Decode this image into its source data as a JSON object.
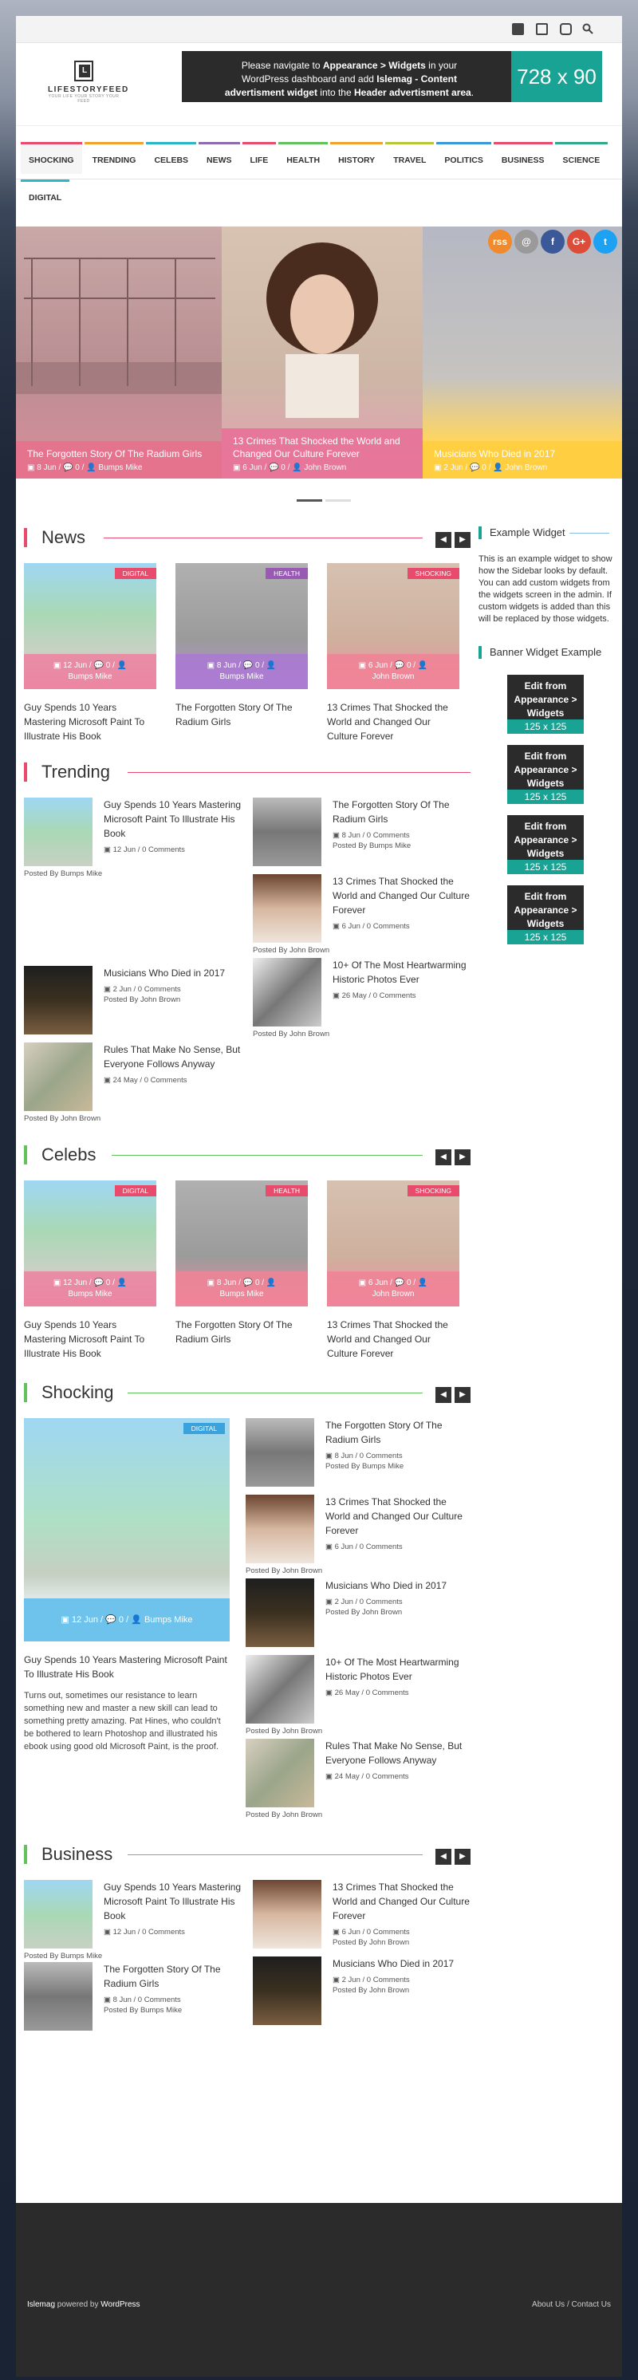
{
  "topbar": {
    "icons": [
      "facebook-icon",
      "twitter-icon",
      "instagram-icon",
      "search-icon"
    ]
  },
  "logo": {
    "letter": "L",
    "name": "LIFESTORYFEED",
    "tagline": "YOUR LIFE YOUR STORY YOUR FEED"
  },
  "header_ad": {
    "line1_a": "Please navigate to ",
    "line1_b": "Appearance > Widgets",
    "line1_c": " in your",
    "line2": "WordPress dashboard and add ",
    "line2_b": "Islemag - Content",
    "line3_b": "advertisment widget",
    "line3_c": " into the ",
    "line3_d": "Header advertisment area",
    "line3_e": ".",
    "size": "728 x 90"
  },
  "nav": {
    "items": [
      "SHOCKING",
      "TRENDING",
      "CELEBS",
      "NEWS",
      "LIFE",
      "HEALTH",
      "HISTORY",
      "TRAVEL",
      "POLITICS",
      "BUSINESS",
      "SCIENCE",
      "DIGITAL"
    ]
  },
  "slides": [
    {
      "title": "The Forgotten Story Of The Radium Girls",
      "date": "8 Jun",
      "comments": "0",
      "author": "Bumps Mike"
    },
    {
      "title": "13 Crimes That Shocked the World and Changed Our Culture Forever",
      "date": "6 Jun",
      "comments": "0",
      "author": "John Brown"
    },
    {
      "title": "Musicians Who Died in 2017",
      "date": "2 Jun",
      "comments": "0",
      "author": "John Brown"
    }
  ],
  "social_buttons": [
    "rss-icon",
    "email-icon",
    "facebook-icon",
    "google-plus-icon",
    "twitter-icon"
  ],
  "social_labels": {
    "rss": "rss",
    "email": "@",
    "facebook": "f",
    "google": "G+",
    "twitter": "t"
  },
  "news": {
    "title": "News",
    "cards": [
      {
        "badge": "DIGITAL",
        "date": "12 Jun",
        "comments": "0",
        "author": "Bumps Mike",
        "title": "Guy Spends 10 Years Mastering Microsoft Paint To Illustrate His Book"
      },
      {
        "badge": "HEALTH",
        "date": "8 Jun",
        "comments": "0",
        "author": "Bumps Mike",
        "title": "The Forgotten Story Of The Radium Girls"
      },
      {
        "badge": "SHOCKING",
        "date": "6 Jun",
        "comments": "0",
        "author": "John Brown",
        "title": "13 Crimes That Shocked the World and Changed Our Culture Forever"
      }
    ]
  },
  "trending": {
    "title": "Trending",
    "posts": [
      {
        "title": "Guy Spends 10 Years Mastering Microsoft Paint To Illustrate His Book",
        "date": "12 Jun",
        "comments": "0 Comments",
        "by": "Posted By Bumps Mike"
      },
      {
        "title": "The Forgotten Story Of The Radium Girls",
        "date": "8 Jun",
        "comments": "0 Comments",
        "by": "Posted By Bumps Mike"
      },
      {
        "title": "13 Crimes That Shocked the World and Changed Our Culture Forever",
        "date": "6 Jun",
        "comments": "0 Comments",
        "by": "Posted By John Brown"
      },
      {
        "title": "Musicians Who Died in 2017",
        "date": "2 Jun",
        "comments": "0 Comments",
        "by": "Posted By John Brown"
      },
      {
        "title": "10+ Of The Most Heartwarming Historic Photos Ever",
        "date": "26 May",
        "comments": "0 Comments",
        "by": "Posted By John Brown"
      },
      {
        "title": "Rules That Make No Sense, But Everyone Follows Anyway",
        "date": "24 May",
        "comments": "0 Comments",
        "by": "Posted By John Brown"
      }
    ]
  },
  "celebs": {
    "title": "Celebs",
    "cards": [
      {
        "badge": "DIGITAL",
        "date": "12 Jun",
        "comments": "0",
        "author": "Bumps Mike",
        "title": "Guy Spends 10 Years Mastering Microsoft Paint To Illustrate His Book"
      },
      {
        "badge": "HEALTH",
        "date": "8 Jun",
        "comments": "0",
        "author": "Bumps Mike",
        "title": "The Forgotten Story Of The Radium Girls"
      },
      {
        "badge": "SHOCKING",
        "date": "6 Jun",
        "comments": "0",
        "author": "John Brown",
        "title": "13 Crimes That Shocked the World and Changed Our Culture Forever"
      }
    ]
  },
  "shocking": {
    "title": "Shocking",
    "main": {
      "badge": "DIGITAL",
      "date": "12 Jun",
      "comments": "0",
      "author": "Bumps Mike",
      "title": "Guy Spends 10 Years Mastering Microsoft Paint To Illustrate His Book",
      "excerpt": "Turns out, sometimes our resistance to learn something new and master a new skill can lead to something pretty amazing. Pat Hines, who couldn't be bothered to learn Photoshop and illustrated his ebook using good old Microsoft Paint, is the proof."
    },
    "posts": [
      {
        "title": "The Forgotten Story Of The Radium Girls",
        "date": "8 Jun",
        "comments": "0 Comments",
        "by": "Posted By Bumps Mike"
      },
      {
        "title": "13 Crimes That Shocked the World and Changed Our Culture Forever",
        "date": "6 Jun",
        "comments": "0 Comments",
        "by": "Posted By John Brown"
      },
      {
        "title": "Musicians Who Died in 2017",
        "date": "2 Jun",
        "comments": "0 Comments",
        "by": "Posted By John Brown"
      },
      {
        "title": "10+ Of The Most Heartwarming Historic Photos Ever",
        "date": "26 May",
        "comments": "0 Comments",
        "by": "Posted By John Brown"
      },
      {
        "title": "Rules That Make No Sense, But Everyone Follows Anyway",
        "date": "24 May",
        "comments": "0 Comments",
        "by": "Posted By John Brown"
      }
    ]
  },
  "business": {
    "title": "Business",
    "posts": [
      {
        "title": "Guy Spends 10 Years Mastering Microsoft Paint To Illustrate His Book",
        "date": "12 Jun",
        "comments": "0 Comments",
        "by": "Posted By Bumps Mike"
      },
      {
        "title": "13 Crimes That Shocked the World and Changed Our Culture Forever",
        "date": "6 Jun",
        "comments": "0 Comments",
        "by": "Posted By John Brown"
      },
      {
        "title": "The Forgotten Story Of The Radium Girls",
        "date": "8 Jun",
        "comments": "0 Comments",
        "by": "Posted By Bumps Mike"
      },
      {
        "title": "Musicians Who Died in 2017",
        "date": "2 Jun",
        "comments": "0 Comments",
        "by": "Posted By John Brown"
      }
    ]
  },
  "sidebar": {
    "example_title": "Example Widget",
    "example_text": "This is an example widget to show how the Sidebar looks by default. You can add custom widgets from the widgets screen in the admin. If custom widgets is added than this will be replaced by those widgets.",
    "banner_title": "Banner Widget Example",
    "banner_text": "Edit from Appearance > Widgets",
    "banner_size": "125 x 125"
  },
  "footer": {
    "credit_a": "Islemag",
    "credit_b": " powered by ",
    "credit_c": "WordPress",
    "links": [
      "About Us",
      "Contact Us"
    ],
    "sep": "/"
  },
  "colors": {
    "accent": "#19a394",
    "nav_pink": "#e84b6c",
    "dark": "#2b2b2b"
  }
}
